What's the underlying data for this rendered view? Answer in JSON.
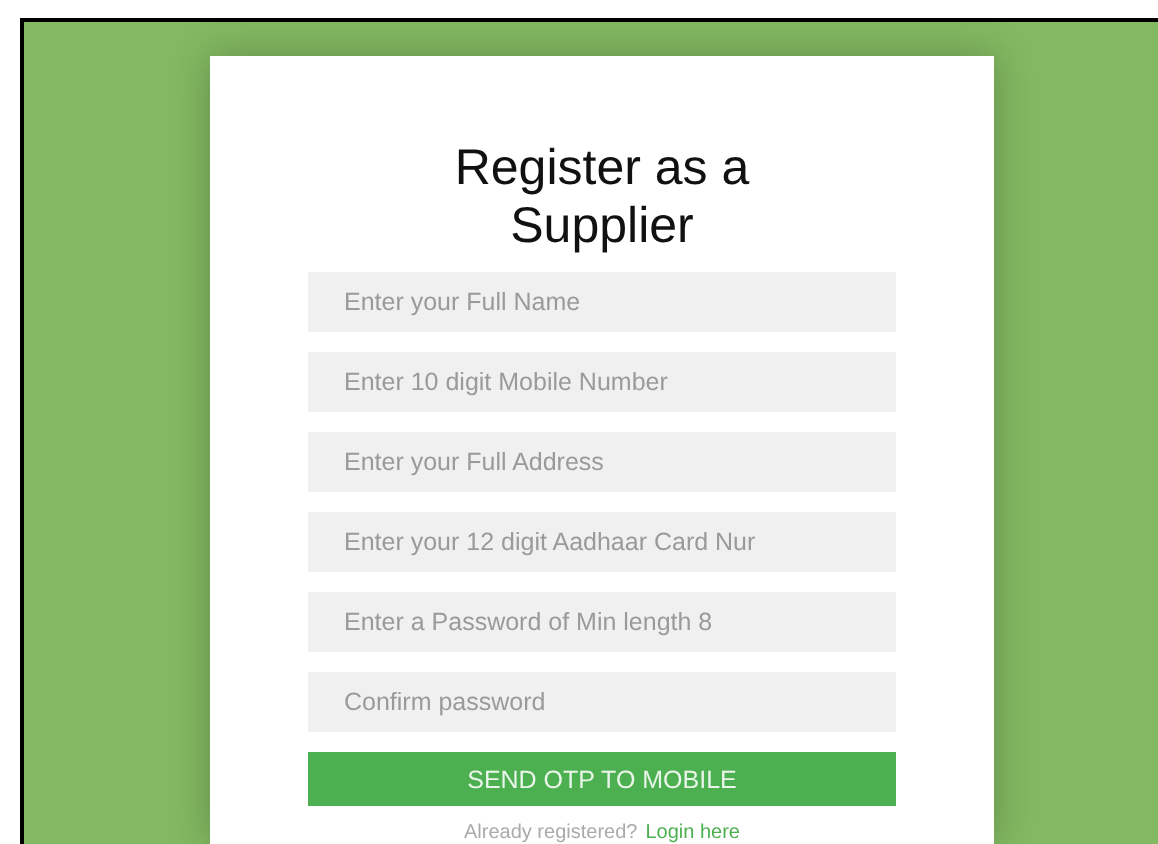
{
  "title": "Register as a Supplier",
  "fields": [
    {
      "placeholder": "Enter your Full Name"
    },
    {
      "placeholder": "Enter 10 digit Mobile Number"
    },
    {
      "placeholder": "Enter your Full Address"
    },
    {
      "placeholder": "Enter your 12 digit Aadhaar Card Nur"
    },
    {
      "placeholder": "Enter a Password of Min length 8"
    },
    {
      "placeholder": "Confirm password"
    }
  ],
  "button": "SEND OTP TO MOBILE",
  "footer": {
    "text": "Already registered?",
    "link": "Login here"
  }
}
